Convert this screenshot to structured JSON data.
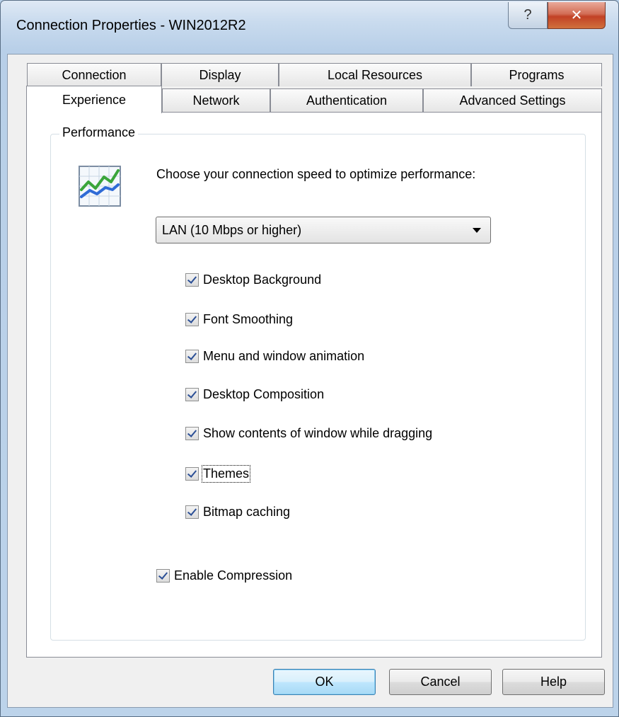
{
  "window": {
    "title": "Connection Properties - WIN2012R2"
  },
  "title_buttons": {
    "help": "?",
    "close": "✕"
  },
  "tabs": {
    "row_top": [
      "Connection",
      "Display",
      "Local Resources",
      "Programs"
    ],
    "row_bottom": [
      "Experience",
      "Network",
      "Authentication",
      "Advanced Settings"
    ],
    "active": "Experience"
  },
  "performance": {
    "group_label": "Performance",
    "prompt": "Choose your connection speed to optimize performance:",
    "speed_selected": "LAN (10 Mbps or higher)",
    "options": [
      {
        "label": "Desktop Background",
        "checked": true
      },
      {
        "label": "Font Smoothing",
        "checked": true
      },
      {
        "label": "Menu and window animation",
        "checked": true
      },
      {
        "label": "Desktop Composition",
        "checked": true
      },
      {
        "label": "Show contents of window while dragging",
        "checked": true
      },
      {
        "label": "Themes",
        "checked": true
      },
      {
        "label": "Bitmap caching",
        "checked": true
      }
    ],
    "compression": {
      "label": "Enable Compression",
      "checked": true
    }
  },
  "buttons": {
    "ok": "OK",
    "cancel": "Cancel",
    "help": "Help"
  }
}
